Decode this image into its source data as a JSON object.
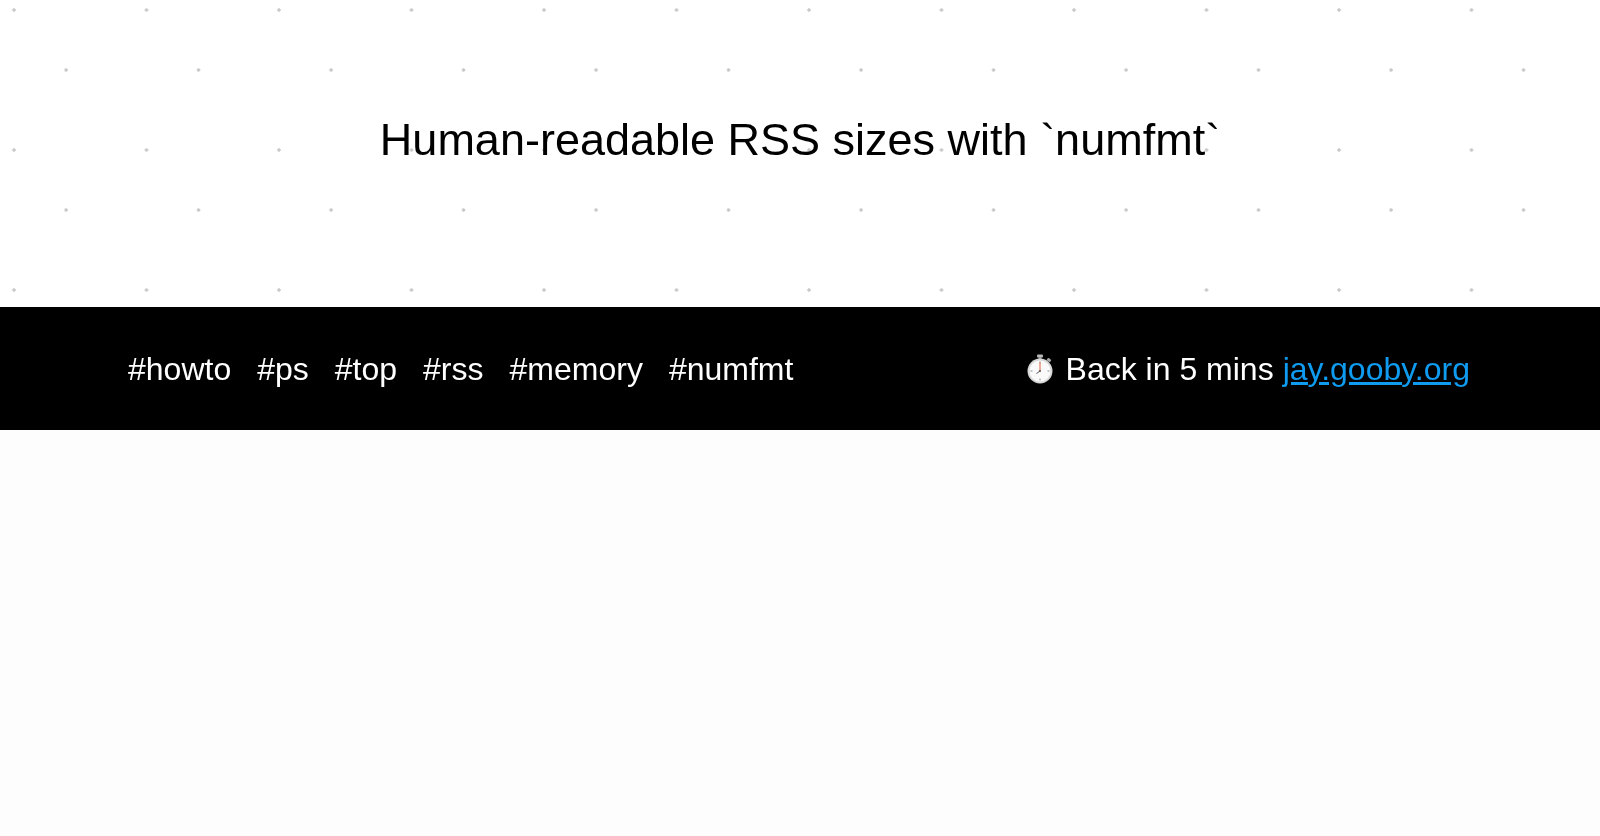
{
  "title": "Human-readable RSS sizes with `numfmt`",
  "footer_bar": {
    "tags": [
      "#howto",
      "#ps",
      "#top",
      "#rss",
      "#memory",
      "#numfmt"
    ],
    "status": "Back in 5 mins",
    "link": "jay.gooby.org"
  }
}
